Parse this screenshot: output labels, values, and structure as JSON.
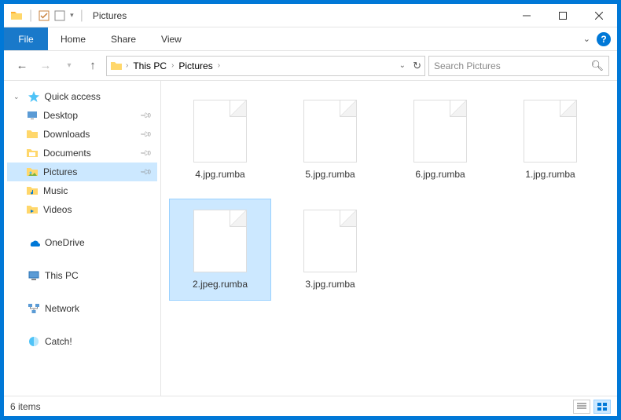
{
  "titlebar": {
    "title": "Pictures"
  },
  "ribbon": {
    "file": "File",
    "tabs": [
      "Home",
      "Share",
      "View"
    ]
  },
  "nav": {
    "breadcrumbs": [
      "This PC",
      "Pictures"
    ],
    "search_placeholder": "Search Pictures"
  },
  "sidebar": {
    "quick_access": {
      "label": "Quick access",
      "items": [
        {
          "label": "Desktop",
          "pinned": true,
          "icon": "desktop"
        },
        {
          "label": "Downloads",
          "pinned": true,
          "icon": "folder"
        },
        {
          "label": "Documents",
          "pinned": true,
          "icon": "documents"
        },
        {
          "label": "Pictures",
          "pinned": true,
          "icon": "pictures",
          "selected": true
        },
        {
          "label": "Music",
          "pinned": false,
          "icon": "music"
        },
        {
          "label": "Videos",
          "pinned": false,
          "icon": "videos"
        }
      ]
    },
    "onedrive": {
      "label": "OneDrive"
    },
    "thispc": {
      "label": "This PC"
    },
    "network": {
      "label": "Network"
    },
    "catch": {
      "label": "Catch!"
    }
  },
  "files": [
    {
      "name": "4.jpg.rumba",
      "selected": false
    },
    {
      "name": "5.jpg.rumba",
      "selected": false
    },
    {
      "name": "6.jpg.rumba",
      "selected": false
    },
    {
      "name": "1.jpg.rumba",
      "selected": false
    },
    {
      "name": "2.jpeg.rumba",
      "selected": true
    },
    {
      "name": "3.jpg.rumba",
      "selected": false
    }
  ],
  "statusbar": {
    "count": "6 items"
  }
}
